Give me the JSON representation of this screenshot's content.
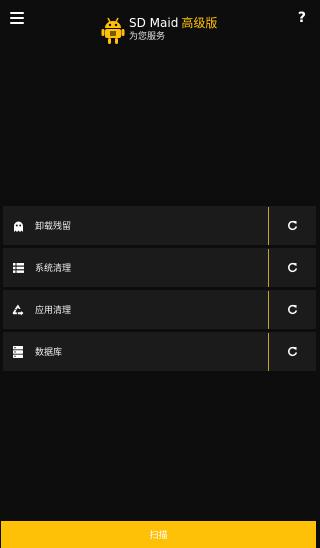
{
  "header": {
    "title": "SD Maid",
    "title_accent": "高级版",
    "subtitle": "为您服务",
    "help_label": "?"
  },
  "colors": {
    "background": "#0d0d0d",
    "row_background": "#1b1b1b",
    "accent": "#ffc107",
    "divider": "#c9a227"
  },
  "tools": [
    {
      "label": "卸载残留",
      "icon": "ghost-icon"
    },
    {
      "label": "系统清理",
      "icon": "list-icon"
    },
    {
      "label": "应用清理",
      "icon": "recycle-icon"
    },
    {
      "label": "数据库",
      "icon": "database-icon"
    }
  ],
  "scan_button": {
    "label": "扫描"
  }
}
